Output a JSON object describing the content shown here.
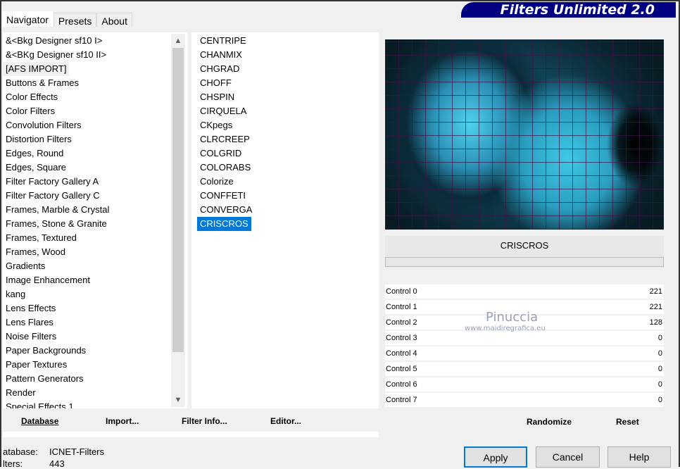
{
  "app": {
    "brand": "Filters Unlimited 2.0"
  },
  "tabs": [
    {
      "label": "Navigator",
      "active": true
    },
    {
      "label": "Presets"
    },
    {
      "label": "About"
    }
  ],
  "categories": [
    "&<Bkg Designer sf10 I>",
    "&<BKg Designer sf10 II>",
    "[AFS IMPORT]",
    "Buttons & Frames",
    "Color Effects",
    "Color Filters",
    "Convolution Filters",
    "Distortion Filters",
    "Edges, Round",
    "Edges, Square",
    "Filter Factory Gallery A",
    "Filter Factory Gallery C",
    "Frames, Marble & Crystal",
    "Frames, Stone & Granite",
    "Frames, Textured",
    "Frames, Wood",
    "Gradients",
    "Image Enhancement",
    "kang",
    "Lens Effects",
    "Lens Flares",
    "Noise Filters",
    "Paper Backgrounds",
    "Paper Textures",
    "Pattern Generators",
    "Render",
    "Special Effects 1"
  ],
  "selected_category": "[AFS IMPORT]",
  "filters": [
    "CENTRIPE",
    "CHANMIX",
    "CHGRAD",
    "CHOFF",
    "CHSPIN",
    "CIRQUELA",
    "CKpegs",
    "CLRCREEP",
    "COLGRID",
    "COLORABS",
    "Colorize",
    "CONFFETI",
    "CONVERGA",
    "CRISCROS"
  ],
  "selected_filter": "CRISCROS",
  "preview": {
    "title": "CRISCROS"
  },
  "controls": [
    {
      "label": "Control 0",
      "value": 221
    },
    {
      "label": "Control 1",
      "value": 221
    },
    {
      "label": "Control 2",
      "value": 128
    },
    {
      "label": "Control 3",
      "value": 0
    },
    {
      "label": "Control 4",
      "value": 0
    },
    {
      "label": "Control 5",
      "value": 0
    },
    {
      "label": "Control 6",
      "value": 0
    },
    {
      "label": "Control 7",
      "value": 0
    }
  ],
  "watermark": {
    "name": "Pinuccia",
    "url": "www.maidiregrafica.eu"
  },
  "left_buttons": {
    "database": "Database",
    "import": "Import...",
    "filter_info": "Filter Info...",
    "editor": "Editor..."
  },
  "right_buttons": {
    "randomize": "Randomize",
    "reset": "Reset"
  },
  "status": {
    "database_label": "atabase:",
    "database_value": "ICNET-Filters",
    "filters_label": "lters:",
    "filters_value": "443"
  },
  "dialog_buttons": {
    "apply": "Apply",
    "cancel": "Cancel",
    "help": "Help"
  }
}
